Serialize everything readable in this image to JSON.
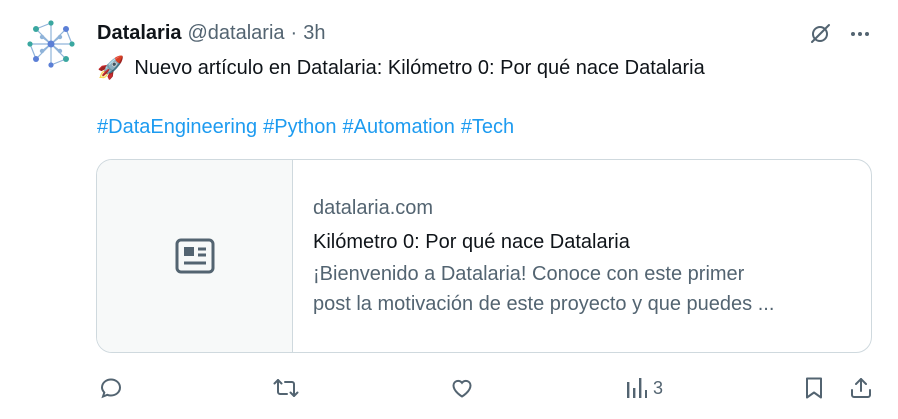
{
  "post": {
    "author_name": "Datalaria",
    "handle": "@datalaria",
    "separator": "·",
    "time": "3h",
    "emoji": "🚀",
    "text": "Nuevo artículo en Datalaria: Kilómetro 0: Por qué nace Datalaria",
    "hashtags": [
      "#DataEngineering",
      "#Python",
      "#Automation",
      "#Tech"
    ]
  },
  "link_card": {
    "domain": "datalaria.com",
    "title": "Kilómetro 0: Por qué nace Datalaria",
    "description_line1": "¡Bienvenido a Datalaria! Conoce con este primer",
    "description_line2": "post la motivación de este proyecto y que puedes ...",
    "thumbnail_icon": "article-icon"
  },
  "actions": {
    "views_count": "3"
  },
  "colors": {
    "link": "#1d9bf0",
    "muted": "#536471",
    "text": "#0f1419",
    "border": "#cfd9de",
    "avatar_teal": "#3aa7a0",
    "avatar_blue": "#5b7fd6"
  }
}
